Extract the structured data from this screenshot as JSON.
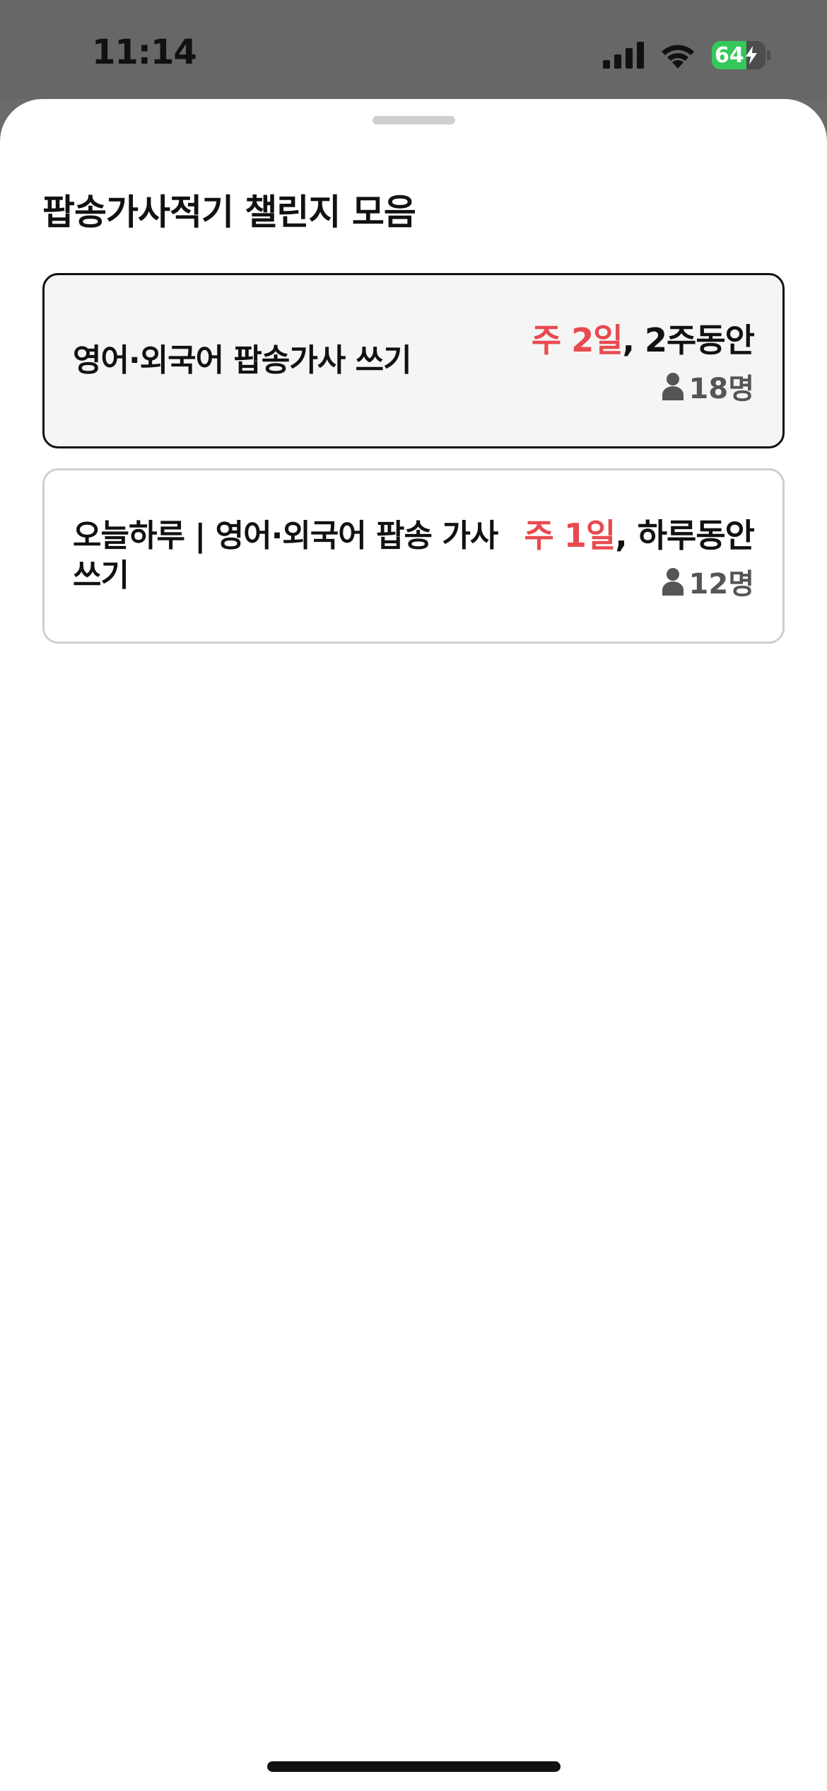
{
  "status_bar": {
    "time": "11:14",
    "battery_level": "64",
    "battery_fraction": 0.64,
    "icons": [
      "signal-icon",
      "wifi-icon",
      "battery-icon",
      "charging-bolt-icon"
    ]
  },
  "sheet": {
    "title": "팝송가사적기 챌린지 모음",
    "challenges": [
      {
        "title": "영어·외국어 팝송가사 쓰기",
        "frequency": "주 2일",
        "separator": ", ",
        "duration": "2주동안",
        "members": "18명",
        "selected": true
      },
      {
        "title": "오늘하루 | 영어·외국어 팝송 가사 쓰기",
        "frequency": "주 1일",
        "separator": ", ",
        "duration": "하루동안",
        "members": "12명",
        "selected": false
      }
    ]
  },
  "colors": {
    "accent_red": "#e84a4f",
    "battery_green": "#34c759",
    "text_primary": "#111111",
    "text_secondary": "#555555"
  }
}
